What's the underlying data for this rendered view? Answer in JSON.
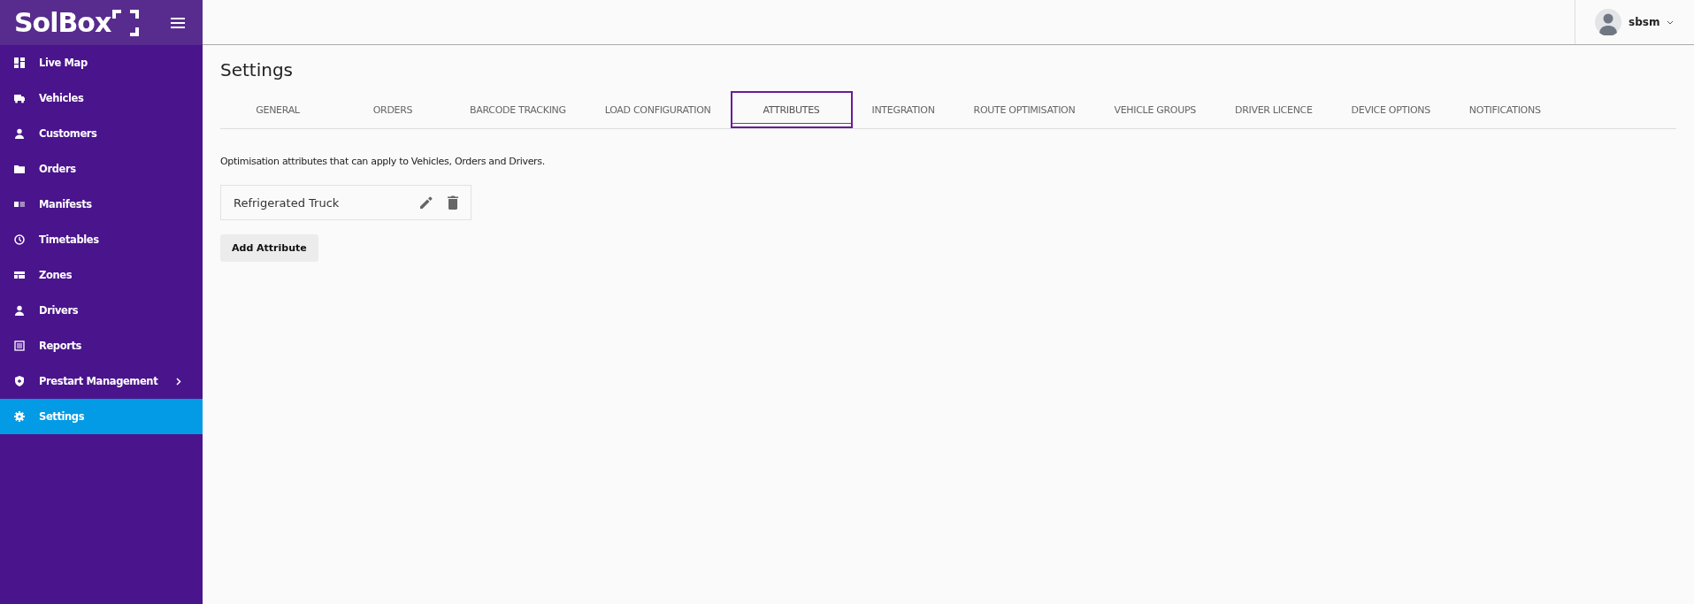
{
  "brand": {
    "logo": "SolBox"
  },
  "sidebar": {
    "items": [
      {
        "label": "Live Map",
        "selected": false,
        "has_submenu": false
      },
      {
        "label": "Vehicles",
        "selected": false,
        "has_submenu": false
      },
      {
        "label": "Customers",
        "selected": false,
        "has_submenu": false
      },
      {
        "label": "Orders",
        "selected": false,
        "has_submenu": false
      },
      {
        "label": "Manifests",
        "selected": false,
        "has_submenu": false
      },
      {
        "label": "Timetables",
        "selected": false,
        "has_submenu": false
      },
      {
        "label": "Zones",
        "selected": false,
        "has_submenu": false
      },
      {
        "label": "Drivers",
        "selected": false,
        "has_submenu": false
      },
      {
        "label": "Reports",
        "selected": false,
        "has_submenu": false
      },
      {
        "label": "Prestart Management",
        "selected": false,
        "has_submenu": true
      },
      {
        "label": "Settings",
        "selected": true,
        "has_submenu": false
      }
    ]
  },
  "user": {
    "name": "sbsm"
  },
  "page": {
    "title": "Settings",
    "tabs": [
      {
        "label": "GENERAL",
        "selected": false
      },
      {
        "label": "ORDERS",
        "selected": false
      },
      {
        "label": "BARCODE TRACKING",
        "selected": false
      },
      {
        "label": "LOAD CONFIGURATION",
        "selected": false
      },
      {
        "label": "ATTRIBUTES",
        "selected": true
      },
      {
        "label": "INTEGRATION",
        "selected": false
      },
      {
        "label": "ROUTE OPTIMISATION",
        "selected": false
      },
      {
        "label": "VEHICLE GROUPS",
        "selected": false
      },
      {
        "label": "DRIVER LICENCE",
        "selected": false
      },
      {
        "label": "DEVICE OPTIONS",
        "selected": false
      },
      {
        "label": "NOTIFICATIONS",
        "selected": false
      }
    ],
    "description": "Optimisation attributes that can apply to Vehicles, Orders and Drivers.",
    "attributes": [
      {
        "name": "Refrigerated Truck"
      }
    ],
    "add_button": "Add Attribute"
  }
}
